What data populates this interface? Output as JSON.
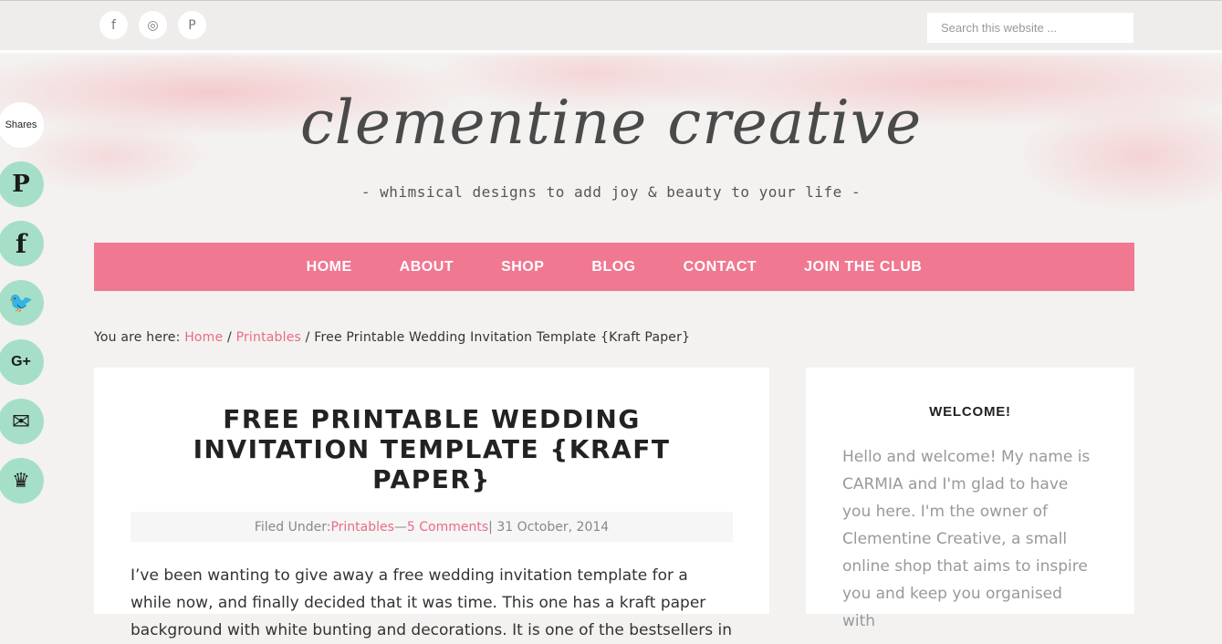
{
  "topbar": {
    "social": [
      {
        "icon": "facebook-icon",
        "glyph": "f"
      },
      {
        "icon": "instagram-icon",
        "glyph": "◎"
      },
      {
        "icon": "pinterest-icon",
        "glyph": "P"
      }
    ],
    "search_placeholder": "Search this website ..."
  },
  "header": {
    "logo": "clementine creative",
    "tagline": "- whimsical designs to add joy & beauty to your life -"
  },
  "nav": [
    "HOME",
    "ABOUT",
    "SHOP",
    "BLOG",
    "CONTACT",
    "JOIN THE CLUB"
  ],
  "share": {
    "label": "Shares",
    "buttons": [
      {
        "icon": "pinterest-icon",
        "glyph": "P"
      },
      {
        "icon": "facebook-icon",
        "glyph": "f"
      },
      {
        "icon": "twitter-icon",
        "glyph": "🐦"
      },
      {
        "icon": "google-plus-icon",
        "glyph": "G+"
      },
      {
        "icon": "email-icon",
        "glyph": "✉"
      },
      {
        "icon": "crown-icon",
        "glyph": "♛"
      }
    ]
  },
  "breadcrumb": {
    "prefix": "You are here: ",
    "home": "Home",
    "sep1": " / ",
    "category": "Printables",
    "sep2": " / ",
    "current": "Free Printable Wedding Invitation Template {Kraft Paper}"
  },
  "post": {
    "title": "FREE PRINTABLE WEDDING INVITATION TEMPLATE {KRAFT PAPER}",
    "meta_prefix": "Filed Under: ",
    "meta_category": "Printables",
    "meta_dash": " — ",
    "meta_comments": "5 Comments",
    "meta_date": " | 31 October, 2014",
    "body": "I’ve been wanting to give away a free wedding invitation template for a while now, and finally decided that it was time. This one has a kraft paper background with white bunting and decorations. It is one of the bestsellers in"
  },
  "sidebar": {
    "title": "WELCOME!",
    "text": "Hello and welcome! My name is CARMIA and I'm glad to have you here. I'm the owner of Clementine Creative, a small online shop that aims to inspire you and keep you organised with"
  },
  "colors": {
    "accent_pink": "#f07891",
    "link_pink": "#e96c84",
    "share_mint": "#a6dfc8"
  }
}
